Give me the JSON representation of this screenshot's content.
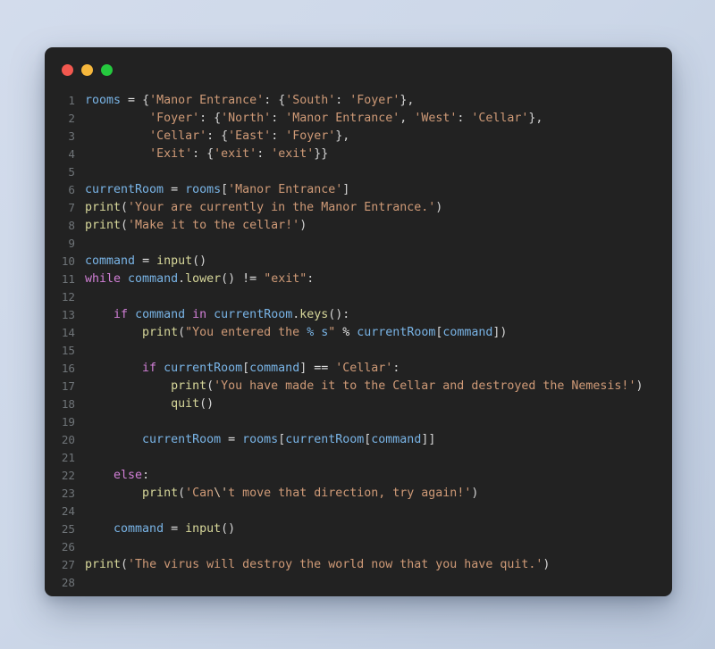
{
  "window": {
    "traffic_lights": [
      {
        "name": "close",
        "color": "#f2584f"
      },
      {
        "name": "minimize",
        "color": "#f6b73c"
      },
      {
        "name": "maximize",
        "color": "#25c93e"
      }
    ],
    "background": "#222222",
    "page_background": "#ccd7e8"
  },
  "editor": {
    "language": "python",
    "line_numbers": [
      "1",
      "2",
      "3",
      "4",
      "5",
      "6",
      "7",
      "8",
      "9",
      "10",
      "11",
      "12",
      "13",
      "14",
      "15",
      "16",
      "17",
      "18",
      "19",
      "20",
      "21",
      "22",
      "23",
      "24",
      "25",
      "26",
      "27",
      "28"
    ],
    "lines": [
      {
        "n": "1",
        "text": "rooms = {'Manor Entrance': {'South': 'Foyer'},"
      },
      {
        "n": "2",
        "text": "         'Foyer': {'North': 'Manor Entrance', 'West': 'Cellar'},"
      },
      {
        "n": "3",
        "text": "         'Cellar': {'East': 'Foyer'},"
      },
      {
        "n": "4",
        "text": "         'Exit': {'exit': 'exit'}}"
      },
      {
        "n": "5",
        "text": ""
      },
      {
        "n": "6",
        "text": "currentRoom = rooms['Manor Entrance']"
      },
      {
        "n": "7",
        "text": "print('Your are currently in the Manor Entrance.')"
      },
      {
        "n": "8",
        "text": "print('Make it to the cellar!')"
      },
      {
        "n": "9",
        "text": ""
      },
      {
        "n": "10",
        "text": "command = input()"
      },
      {
        "n": "11",
        "text": "while command.lower() != \"exit\":"
      },
      {
        "n": "12",
        "text": ""
      },
      {
        "n": "13",
        "text": "    if command in currentRoom.keys():"
      },
      {
        "n": "14",
        "text": "        print(\"You entered the % s\" % currentRoom[command])"
      },
      {
        "n": "15",
        "text": ""
      },
      {
        "n": "16",
        "text": "        if currentRoom[command] == 'Cellar':"
      },
      {
        "n": "17",
        "text": "            print('You have made it to the Cellar and destroyed the Nemesis!')"
      },
      {
        "n": "18",
        "text": "            quit()"
      },
      {
        "n": "19",
        "text": ""
      },
      {
        "n": "20",
        "text": "        currentRoom = rooms[currentRoom[command]]"
      },
      {
        "n": "21",
        "text": ""
      },
      {
        "n": "22",
        "text": "    else:"
      },
      {
        "n": "23",
        "text": "        print('Can\\'t move that direction, try again!')"
      },
      {
        "n": "24",
        "text": ""
      },
      {
        "n": "25",
        "text": "    command = input()"
      },
      {
        "n": "26",
        "text": ""
      },
      {
        "n": "27",
        "text": "print('The virus will destroy the world now that you have quit.')"
      },
      {
        "n": "28",
        "text": ""
      }
    ],
    "tokens": [
      [
        {
          "t": "rooms",
          "c": "t-var"
        },
        {
          "t": " ",
          "c": "t-plain"
        },
        {
          "t": "=",
          "c": "t-op"
        },
        {
          "t": " ",
          "c": "t-plain"
        },
        {
          "t": "{",
          "c": "t-punct"
        },
        {
          "t": "'Manor Entrance'",
          "c": "t-str"
        },
        {
          "t": ": ",
          "c": "t-punct"
        },
        {
          "t": "{",
          "c": "t-punct"
        },
        {
          "t": "'South'",
          "c": "t-str"
        },
        {
          "t": ": ",
          "c": "t-punct"
        },
        {
          "t": "'Foyer'",
          "c": "t-str"
        },
        {
          "t": "},",
          "c": "t-punct"
        }
      ],
      [
        {
          "t": "         ",
          "c": "t-plain"
        },
        {
          "t": "'Foyer'",
          "c": "t-str"
        },
        {
          "t": ": ",
          "c": "t-punct"
        },
        {
          "t": "{",
          "c": "t-punct"
        },
        {
          "t": "'North'",
          "c": "t-str"
        },
        {
          "t": ": ",
          "c": "t-punct"
        },
        {
          "t": "'Manor Entrance'",
          "c": "t-str"
        },
        {
          "t": ", ",
          "c": "t-punct"
        },
        {
          "t": "'West'",
          "c": "t-str"
        },
        {
          "t": ": ",
          "c": "t-punct"
        },
        {
          "t": "'Cellar'",
          "c": "t-str"
        },
        {
          "t": "},",
          "c": "t-punct"
        }
      ],
      [
        {
          "t": "         ",
          "c": "t-plain"
        },
        {
          "t": "'Cellar'",
          "c": "t-str"
        },
        {
          "t": ": ",
          "c": "t-punct"
        },
        {
          "t": "{",
          "c": "t-punct"
        },
        {
          "t": "'East'",
          "c": "t-str"
        },
        {
          "t": ": ",
          "c": "t-punct"
        },
        {
          "t": "'Foyer'",
          "c": "t-str"
        },
        {
          "t": "},",
          "c": "t-punct"
        }
      ],
      [
        {
          "t": "         ",
          "c": "t-plain"
        },
        {
          "t": "'Exit'",
          "c": "t-str"
        },
        {
          "t": ": ",
          "c": "t-punct"
        },
        {
          "t": "{",
          "c": "t-punct"
        },
        {
          "t": "'exit'",
          "c": "t-str"
        },
        {
          "t": ": ",
          "c": "t-punct"
        },
        {
          "t": "'exit'",
          "c": "t-str"
        },
        {
          "t": "}}",
          "c": "t-punct"
        }
      ],
      [],
      [
        {
          "t": "currentRoom",
          "c": "t-var"
        },
        {
          "t": " ",
          "c": "t-plain"
        },
        {
          "t": "=",
          "c": "t-op"
        },
        {
          "t": " ",
          "c": "t-plain"
        },
        {
          "t": "rooms",
          "c": "t-var"
        },
        {
          "t": "[",
          "c": "t-punct"
        },
        {
          "t": "'Manor Entrance'",
          "c": "t-str"
        },
        {
          "t": "]",
          "c": "t-punct"
        }
      ],
      [
        {
          "t": "print",
          "c": "t-fn"
        },
        {
          "t": "(",
          "c": "t-punct"
        },
        {
          "t": "'Your are currently in the Manor Entrance.'",
          "c": "t-str"
        },
        {
          "t": ")",
          "c": "t-punct"
        }
      ],
      [
        {
          "t": "print",
          "c": "t-fn"
        },
        {
          "t": "(",
          "c": "t-punct"
        },
        {
          "t": "'Make it to the cellar!'",
          "c": "t-str"
        },
        {
          "t": ")",
          "c": "t-punct"
        }
      ],
      [],
      [
        {
          "t": "command",
          "c": "t-var"
        },
        {
          "t": " ",
          "c": "t-plain"
        },
        {
          "t": "=",
          "c": "t-op"
        },
        {
          "t": " ",
          "c": "t-plain"
        },
        {
          "t": "input",
          "c": "t-fn"
        },
        {
          "t": "()",
          "c": "t-punct"
        }
      ],
      [
        {
          "t": "while",
          "c": "t-kw"
        },
        {
          "t": " ",
          "c": "t-plain"
        },
        {
          "t": "command",
          "c": "t-var"
        },
        {
          "t": ".",
          "c": "t-punct"
        },
        {
          "t": "lower",
          "c": "t-fn"
        },
        {
          "t": "()",
          "c": "t-punct"
        },
        {
          "t": " ",
          "c": "t-plain"
        },
        {
          "t": "!=",
          "c": "t-op"
        },
        {
          "t": " ",
          "c": "t-plain"
        },
        {
          "t": "\"exit\"",
          "c": "t-str"
        },
        {
          "t": ":",
          "c": "t-punct"
        }
      ],
      [],
      [
        {
          "t": "    ",
          "c": "t-plain"
        },
        {
          "t": "if",
          "c": "t-kw"
        },
        {
          "t": " ",
          "c": "t-plain"
        },
        {
          "t": "command",
          "c": "t-var"
        },
        {
          "t": " ",
          "c": "t-plain"
        },
        {
          "t": "in",
          "c": "t-kw"
        },
        {
          "t": " ",
          "c": "t-plain"
        },
        {
          "t": "currentRoom",
          "c": "t-var"
        },
        {
          "t": ".",
          "c": "t-punct"
        },
        {
          "t": "keys",
          "c": "t-fn"
        },
        {
          "t": "():",
          "c": "t-punct"
        }
      ],
      [
        {
          "t": "        ",
          "c": "t-plain"
        },
        {
          "t": "print",
          "c": "t-fn"
        },
        {
          "t": "(",
          "c": "t-punct"
        },
        {
          "t": "\"You entered the ",
          "c": "t-str"
        },
        {
          "t": "% s",
          "c": "t-fmt"
        },
        {
          "t": "\"",
          "c": "t-str"
        },
        {
          "t": " ",
          "c": "t-plain"
        },
        {
          "t": "%",
          "c": "t-op"
        },
        {
          "t": " ",
          "c": "t-plain"
        },
        {
          "t": "currentRoom",
          "c": "t-var"
        },
        {
          "t": "[",
          "c": "t-punct"
        },
        {
          "t": "command",
          "c": "t-var"
        },
        {
          "t": "])",
          "c": "t-punct"
        }
      ],
      [],
      [
        {
          "t": "        ",
          "c": "t-plain"
        },
        {
          "t": "if",
          "c": "t-kw"
        },
        {
          "t": " ",
          "c": "t-plain"
        },
        {
          "t": "currentRoom",
          "c": "t-var"
        },
        {
          "t": "[",
          "c": "t-punct"
        },
        {
          "t": "command",
          "c": "t-var"
        },
        {
          "t": "]",
          "c": "t-punct"
        },
        {
          "t": " ",
          "c": "t-plain"
        },
        {
          "t": "==",
          "c": "t-op"
        },
        {
          "t": " ",
          "c": "t-plain"
        },
        {
          "t": "'Cellar'",
          "c": "t-str"
        },
        {
          "t": ":",
          "c": "t-punct"
        }
      ],
      [
        {
          "t": "            ",
          "c": "t-plain"
        },
        {
          "t": "print",
          "c": "t-fn"
        },
        {
          "t": "(",
          "c": "t-punct"
        },
        {
          "t": "'You have made it to the Cellar and destroyed the Nemesis!'",
          "c": "t-str"
        },
        {
          "t": ")",
          "c": "t-punct"
        }
      ],
      [
        {
          "t": "            ",
          "c": "t-plain"
        },
        {
          "t": "quit",
          "c": "t-fn"
        },
        {
          "t": "()",
          "c": "t-punct"
        }
      ],
      [],
      [
        {
          "t": "        ",
          "c": "t-plain"
        },
        {
          "t": "currentRoom",
          "c": "t-var"
        },
        {
          "t": " ",
          "c": "t-plain"
        },
        {
          "t": "=",
          "c": "t-op"
        },
        {
          "t": " ",
          "c": "t-plain"
        },
        {
          "t": "rooms",
          "c": "t-var"
        },
        {
          "t": "[",
          "c": "t-punct"
        },
        {
          "t": "currentRoom",
          "c": "t-var"
        },
        {
          "t": "[",
          "c": "t-punct"
        },
        {
          "t": "command",
          "c": "t-var"
        },
        {
          "t": "]]",
          "c": "t-punct"
        }
      ],
      [],
      [
        {
          "t": "    ",
          "c": "t-plain"
        },
        {
          "t": "else",
          "c": "t-kw"
        },
        {
          "t": ":",
          "c": "t-punct"
        }
      ],
      [
        {
          "t": "        ",
          "c": "t-plain"
        },
        {
          "t": "print",
          "c": "t-fn"
        },
        {
          "t": "(",
          "c": "t-punct"
        },
        {
          "t": "'Can",
          "c": "t-str"
        },
        {
          "t": "\\'",
          "c": "t-esc"
        },
        {
          "t": "t move that direction, try again!'",
          "c": "t-str"
        },
        {
          "t": ")",
          "c": "t-punct"
        }
      ],
      [],
      [
        {
          "t": "    ",
          "c": "t-plain"
        },
        {
          "t": "command",
          "c": "t-var"
        },
        {
          "t": " ",
          "c": "t-plain"
        },
        {
          "t": "=",
          "c": "t-op"
        },
        {
          "t": " ",
          "c": "t-plain"
        },
        {
          "t": "input",
          "c": "t-fn"
        },
        {
          "t": "()",
          "c": "t-punct"
        }
      ],
      [],
      [
        {
          "t": "print",
          "c": "t-fn"
        },
        {
          "t": "(",
          "c": "t-punct"
        },
        {
          "t": "'The virus will destroy the world now that you have quit.'",
          "c": "t-str"
        },
        {
          "t": ")",
          "c": "t-punct"
        }
      ],
      []
    ]
  }
}
